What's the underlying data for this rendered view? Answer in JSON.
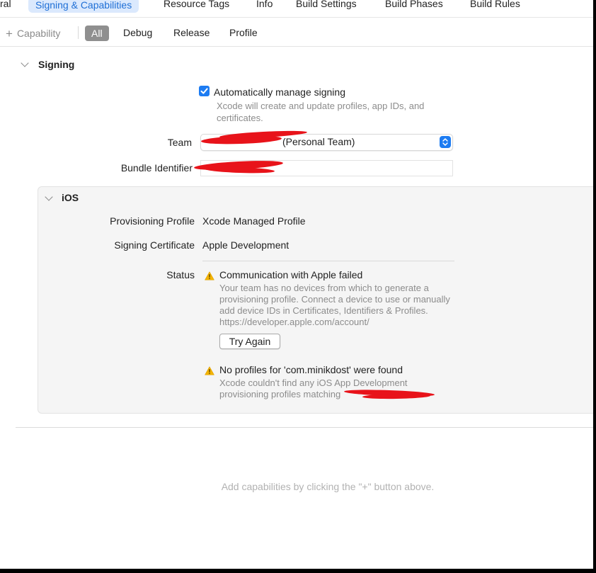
{
  "tabs": [
    {
      "label": "ral",
      "selected": false
    },
    {
      "label": "Signing & Capabilities",
      "selected": true
    },
    {
      "label": "Resource Tags",
      "selected": false
    },
    {
      "label": "Info",
      "selected": false
    },
    {
      "label": "Build Settings",
      "selected": false
    },
    {
      "label": "Build Phases",
      "selected": false
    },
    {
      "label": "Build Rules",
      "selected": false
    }
  ],
  "toolbar": {
    "capability_label": "Capability",
    "filters": [
      "All",
      "Debug",
      "Release",
      "Profile"
    ],
    "selected_filter": "All"
  },
  "signing": {
    "title": "Signing",
    "auto_manage_label": "Automatically manage signing",
    "auto_manage_checked": true,
    "auto_manage_desc": "Xcode will create and update profiles, app IDs, and certificates.",
    "team_label": "Team",
    "team_value": "(Personal Team)",
    "bundle_label": "Bundle Identifier"
  },
  "ios": {
    "title": "iOS",
    "prov_profile_label": "Provisioning Profile",
    "prov_profile_value": "Xcode Managed Profile",
    "sign_cert_label": "Signing Certificate",
    "sign_cert_value": "Apple Development",
    "status_label": "Status",
    "warnings": [
      {
        "title": "Communication with Apple failed",
        "desc": "Your team has no devices from which to generate a provisioning profile. Connect a device to use or manually add device IDs in Certificates, Identifiers & Profiles. https://developer.apple.com/account/"
      },
      {
        "title": "No profiles for 'com.minikdost' were found",
        "desc": "Xcode couldn't find any iOS App Development provisioning profiles matching"
      }
    ],
    "try_again_label": "Try Again"
  },
  "hint": "Add capabilities by clicking the \"+\" button above.",
  "colors": {
    "accent": "#1d7cf2",
    "selected_tab_bg": "#dbe9fd",
    "selected_tab_text": "#1f6fd6",
    "warning": "#f4b400",
    "redaction": "#e8131a"
  }
}
